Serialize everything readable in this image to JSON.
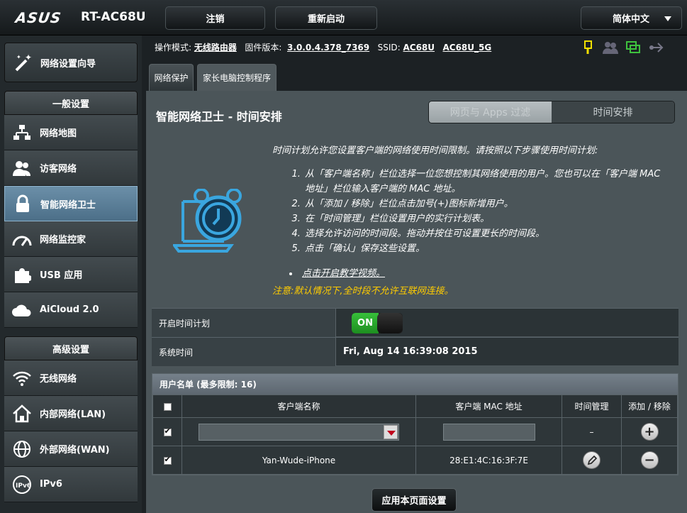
{
  "brand": {
    "logo": "ASUS",
    "model": "RT-AC68U"
  },
  "header": {
    "logout": "注销",
    "reboot": "重新启动",
    "language": "简体中文"
  },
  "info": {
    "mode_label": "操作模式:",
    "mode_value": "无线路由器",
    "fw_label": "固件版本:",
    "fw_value": "3.0.0.4.378_7369",
    "ssid_label": "SSID:",
    "ssid_1": "AC68U",
    "ssid_2": "AC68U_5G"
  },
  "status_icons": [
    "usb-icon",
    "clients-icon",
    "network-icon",
    "usb-plug-icon"
  ],
  "sidebar": {
    "wizard": "网络设置向导",
    "general_head": "一般设置",
    "general": [
      {
        "label": "网络地图",
        "icon": "network-map-icon"
      },
      {
        "label": "访客网络",
        "icon": "guest-network-icon"
      },
      {
        "label": "智能网络卫士",
        "icon": "lock-icon",
        "active": true
      },
      {
        "label": "网络监控家",
        "icon": "gauge-icon"
      },
      {
        "label": "USB 应用",
        "icon": "puzzle-icon"
      },
      {
        "label": "AiCloud 2.0",
        "icon": "cloud-icon"
      }
    ],
    "advanced_head": "高级设置",
    "advanced": [
      {
        "label": "无线网络",
        "icon": "wifi-icon"
      },
      {
        "label": "内部网络(LAN)",
        "icon": "home-icon"
      },
      {
        "label": "外部网络(WAN)",
        "icon": "globe-icon"
      },
      {
        "label": "IPv6",
        "icon": "ipv6-icon"
      }
    ]
  },
  "tabs": [
    "网络保护",
    "家长电脑控制程序"
  ],
  "panel": {
    "title": "智能网络卫士 - 时间安排",
    "switch_web": "网页与 Apps 过滤",
    "switch_time": "时间安排",
    "intro": "时间计划允许您设置客户端的网络使用时间限制。请按照以下步骤使用时间计划:",
    "steps": [
      "从「客户端名称」栏位选择一位您想控制其网络使用的用户。您也可以在「客户端 MAC 地址」栏位输入客户端的 MAC 地址。",
      "从「添加 / 移除」栏位点击加号(+)图标新增用户。",
      "在「时间管理」栏位设置用户的实行计划表。",
      "选择允许访问的时间段。拖动并按住可设置更长的时间段。",
      "点击「确认」保存这些设置。"
    ],
    "tutorial": "点击开启教学视频。",
    "warning": "注意:默认情况下,全时段不允许互联网连接。",
    "enable_label": "开启时间计划",
    "toggle": "ON",
    "systime_label": "系统时间",
    "systime_value": "Fri, Aug 14 16:39:08 2015",
    "list_title": "用户名单 (最多限制: 16)",
    "columns": [
      "客户端名称",
      "客户端 MAC 地址",
      "时间管理",
      "添加 / 移除"
    ],
    "dash": "–",
    "row": {
      "name": "Yan-Wude-iPhone",
      "mac": "28:E1:4C:16:3F:7E"
    },
    "apply": "应用本页面设置"
  },
  "colors": {
    "accent": "#4c6f88",
    "toggle_on": "#2aa82d",
    "warning": "#ffcc00"
  }
}
